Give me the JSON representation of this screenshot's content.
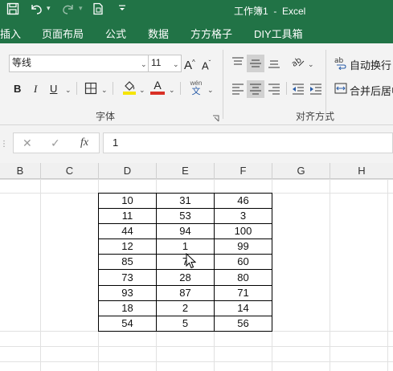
{
  "titlebar": {
    "title": "工作簿1  -  Excel",
    "icons": [
      "save-icon",
      "undo-icon",
      "redo-icon",
      "form-icon",
      "customize-icon"
    ]
  },
  "menu": [
    "插入",
    "页面布局",
    "公式",
    "数据",
    "方方格子",
    "DIY工具箱"
  ],
  "ribbon": {
    "font_name": "等线",
    "font_size": "11",
    "grow_label": "A",
    "shrink_label": "A",
    "bold": "B",
    "italic": "I",
    "underline": "U",
    "font_color_letter": "A",
    "font_color": "#d93025",
    "highlight_color": "#f5e400",
    "phonetic_top": "wén",
    "phonetic_bottom": "文",
    "wrap_label": "自动换行",
    "merge_label": "合并后居中",
    "font_group": "字体",
    "align_group": "对齐方式"
  },
  "formula_bar": {
    "cancel": "✕",
    "enter": "✓",
    "fx": "fx",
    "value": "1"
  },
  "columns": [
    "B",
    "C",
    "D",
    "E",
    "F",
    "G",
    "H"
  ],
  "table": [
    [
      "10",
      "31",
      "46"
    ],
    [
      "11",
      "53",
      "3"
    ],
    [
      "44",
      "94",
      "100"
    ],
    [
      "12",
      "1",
      "99"
    ],
    [
      "85",
      "7",
      "60"
    ],
    [
      "73",
      "28",
      "80"
    ],
    [
      "93",
      "87",
      "71"
    ],
    [
      "18",
      "2",
      "14"
    ],
    [
      "54",
      "5",
      "56"
    ]
  ]
}
